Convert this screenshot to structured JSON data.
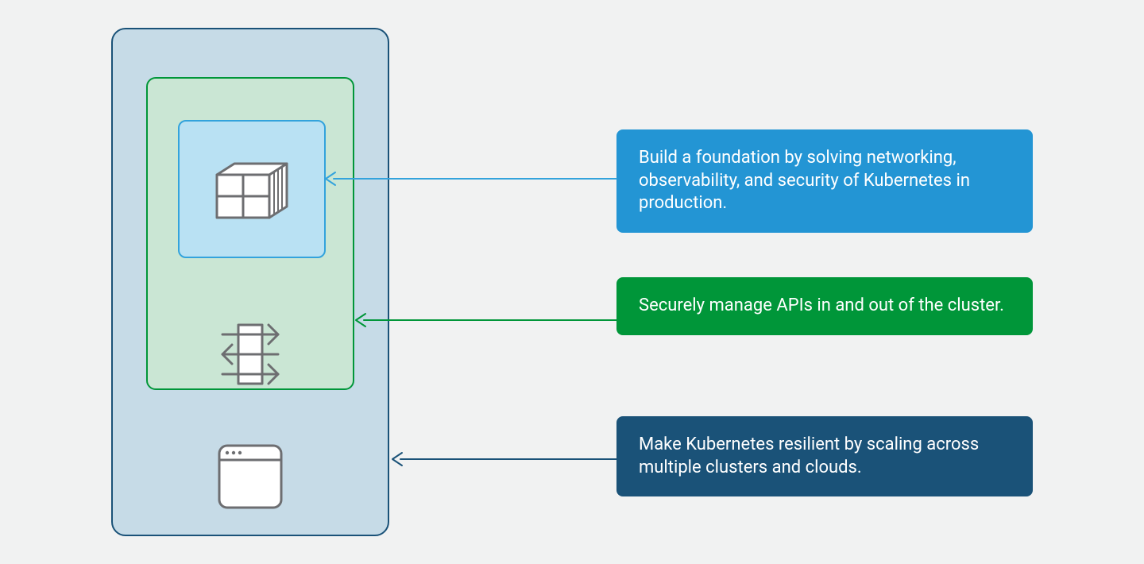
{
  "callouts": [
    "Build a foundation by solving networking, observability, and security of Kubernetes in production.",
    "Securely manage APIs in and out of the cluster.",
    "Make Kubernetes resilient by scaling across multiple clusters and clouds."
  ],
  "colors": {
    "outer_border": "#1a5278",
    "outer_fill": "#c6dbe7",
    "middle_border": "#009639",
    "middle_fill": "#cae6d4",
    "inner_border": "#33a3dc",
    "inner_fill": "#b9e1f3",
    "callout_blue": "#2395d4",
    "callout_green": "#009639",
    "callout_dark": "#1a5278",
    "icon_stroke": "#6d6e71"
  },
  "icons": {
    "inner": "container-stack",
    "middle": "api-arrows",
    "outer": "app-window"
  }
}
